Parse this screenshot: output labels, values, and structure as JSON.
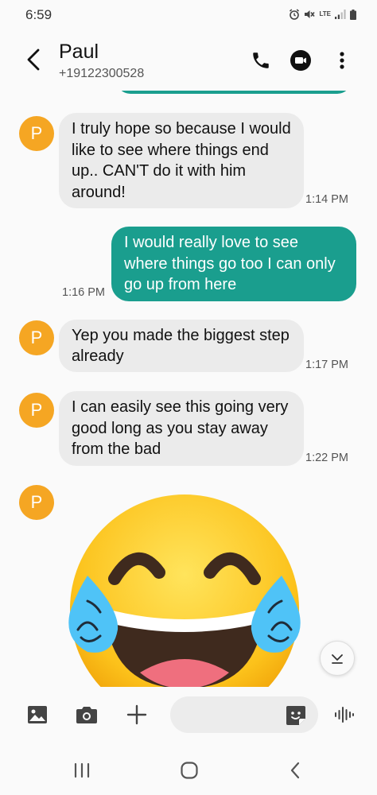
{
  "status_bar": {
    "time": "6:59",
    "network_label": "LTE"
  },
  "header": {
    "contact_name": "Paul",
    "contact_number": "+19122300528",
    "icons": [
      "back-arrow-icon",
      "phone-icon",
      "video-call-icon",
      "more-vert-icon"
    ]
  },
  "messages": [
    {
      "direction": "incoming",
      "avatar_letter": "P",
      "text": "I truly hope so because I would like to see where things end up.. CAN'T do it with him around!",
      "time": "1:14 PM"
    },
    {
      "direction": "outgoing",
      "text": "I would really love to see where things go too I can only go up from here",
      "time": "1:16 PM"
    },
    {
      "direction": "incoming",
      "avatar_letter": "P",
      "text": "Yep you made the biggest step already",
      "time": "1:17 PM"
    },
    {
      "direction": "incoming",
      "avatar_letter": "P",
      "text": "I can easily see this going very good long as you stay away from the bad",
      "time": "1:22 PM"
    },
    {
      "direction": "incoming",
      "avatar_letter": "P",
      "emoji": "face-with-tears-of-joy"
    }
  ],
  "input_bar": {
    "message_value": "",
    "message_placeholder": "",
    "icons": [
      "gallery-icon",
      "camera-icon",
      "plus-icon",
      "sticker-icon",
      "voice-icon"
    ]
  },
  "colors": {
    "outgoing_bubble": "#1a9e8e",
    "incoming_bubble": "#ebebeb",
    "avatar": "#f5a623",
    "background": "#fafafa"
  }
}
